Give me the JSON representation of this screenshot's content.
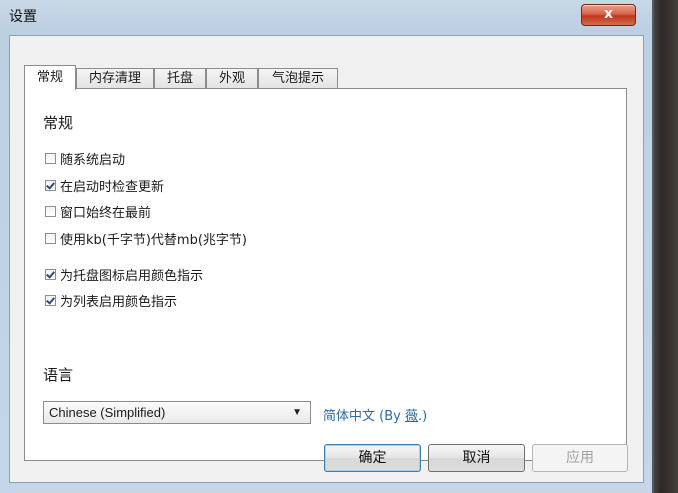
{
  "window": {
    "title": "设置",
    "close_label": "x"
  },
  "tabs": [
    {
      "label": "常规",
      "active": true
    },
    {
      "label": "内存清理",
      "active": false
    },
    {
      "label": "托盘",
      "active": false
    },
    {
      "label": "外观",
      "active": false
    },
    {
      "label": "气泡提示",
      "active": false
    }
  ],
  "general": {
    "heading": "常规",
    "options": [
      {
        "label": "随系统启动",
        "checked": false
      },
      {
        "label": "在启动时检查更新",
        "checked": true
      },
      {
        "label": "窗口始终在最前",
        "checked": false
      },
      {
        "label": "使用kb(千字节)代替mb(兆字节)",
        "checked": false
      },
      {
        "label": "为托盘图标启用颜色指示",
        "checked": true
      },
      {
        "label": "为列表启用颜色指示",
        "checked": true
      }
    ]
  },
  "language": {
    "heading": "语言",
    "selected": "Chinese (Simplified)",
    "credit_prefix": "简体中文 (By ",
    "credit_link": "薇",
    "credit_suffix": ".)"
  },
  "buttons": {
    "ok": "确定",
    "cancel": "取消",
    "apply": "应用"
  },
  "colors": {
    "link": "#2b6aa6",
    "close_button": "#c7442a"
  }
}
